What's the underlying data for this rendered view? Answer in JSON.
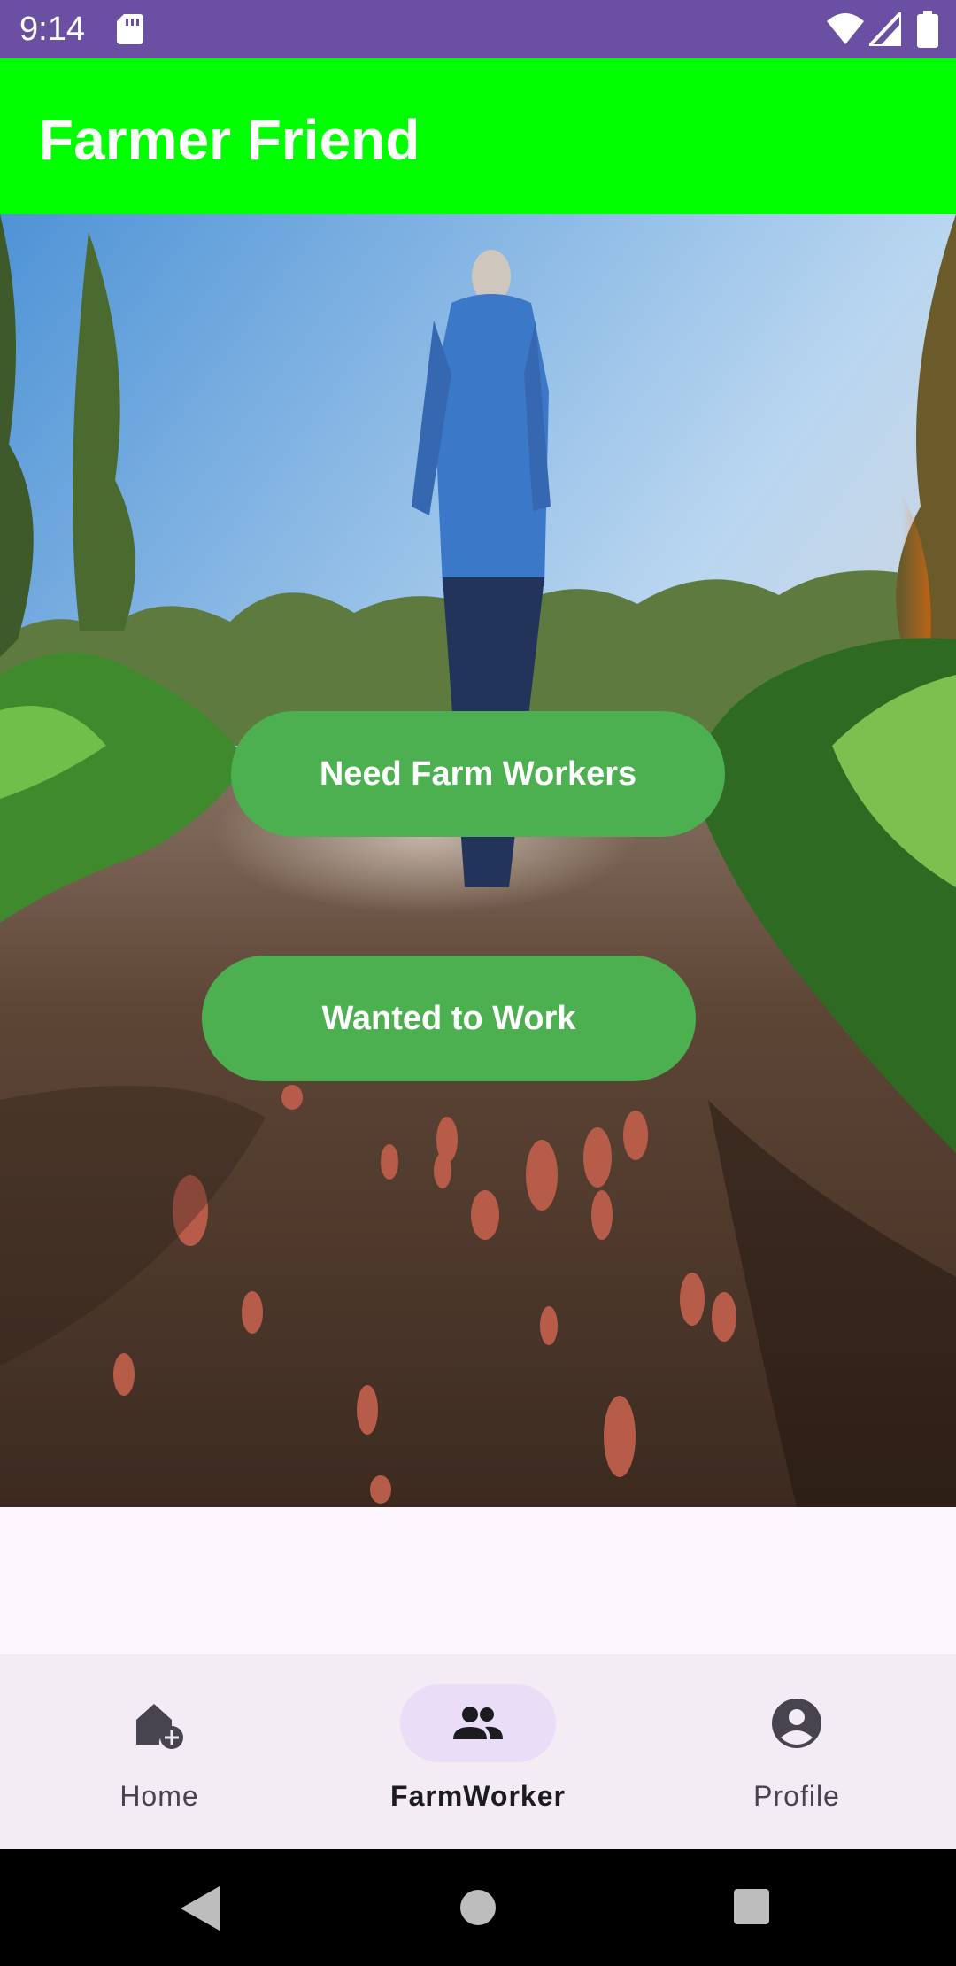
{
  "status_bar": {
    "time": "9:14",
    "icons": [
      "sd-card-icon",
      "wifi-icon",
      "cell-signal-icon",
      "battery-icon"
    ]
  },
  "app_bar": {
    "title": "Farmer Friend",
    "background": "#00ff00"
  },
  "hero": {
    "description_icon": "farm-field-photo",
    "buttons": {
      "need_workers": "Need Farm Workers",
      "wanted_work": "Wanted to Work"
    },
    "button_color": "#4caf50"
  },
  "bottom_nav": {
    "items": [
      {
        "label": "Home",
        "icon": "home-add-icon",
        "active": false
      },
      {
        "label": "FarmWorker",
        "icon": "group-icon",
        "active": true
      },
      {
        "label": "Profile",
        "icon": "account-circle-icon",
        "active": false
      }
    ],
    "active_indicator_color": "#e9ddf8"
  },
  "system_nav": {
    "icons": [
      "back-icon",
      "home-circle-icon",
      "recents-icon"
    ]
  }
}
